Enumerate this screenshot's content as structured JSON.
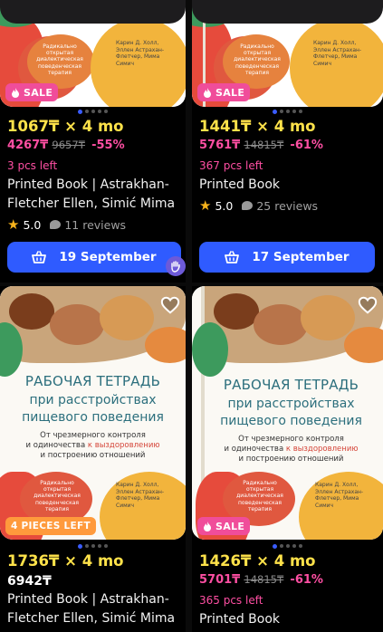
{
  "cards": [
    {
      "badge": "SALE",
      "price_line": "1067₸ × 4 mo",
      "price": "4267₸",
      "old_price": "9657₸",
      "discount": "-55%",
      "stock": "3 pcs left",
      "name": "Printed Book | Astrakhan-Fletcher Ellen, Simić Mima",
      "rating": "5.0",
      "reviews": "11 reviews",
      "button": "19 September"
    },
    {
      "badge": "SALE",
      "price_line": "1441₸ × 4 mo",
      "price": "5761₸",
      "old_price": "14815₸",
      "discount": "-61%",
      "stock": "367 pcs left",
      "name": "Printed Book",
      "rating": "5.0",
      "reviews": "25 reviews",
      "button": "17 September"
    },
    {
      "badge": "4 PIECES LEFT",
      "price_line": "1736₸ × 4 mo",
      "price": "6942₸",
      "name": "Printed Book | Astrakhan-Fletcher Ellen, Simić Mima"
    },
    {
      "badge": "SALE",
      "price_line": "1426₸ × 4 mo",
      "price": "5701₸",
      "old_price": "14815₸",
      "discount": "-61%",
      "stock": "365 pcs left",
      "name": "Printed Book"
    }
  ],
  "book": {
    "title_line1": "РАБОЧАЯ ТЕТРАДЬ",
    "title_line2": "при расстройствах",
    "title_line3": "пищевого поведения",
    "sub_line1": "От чрезмерного контроля",
    "sub_line2": "и одиночества",
    "sub_red": "к выздоровлению",
    "sub_line3": "и построению отношений",
    "blob_text": "Радикально открытая диалектическая поведенческая терапия",
    "authors": "Карин Д. Холл, Эллен Астрахан-Флетчер, Мима Симич"
  },
  "colors": {
    "accent_blue": "#2f5bff",
    "price_yellow": "#ffe24a",
    "sale_pink": "#f04d9a",
    "pieces_orange": "#ff9a3c"
  }
}
